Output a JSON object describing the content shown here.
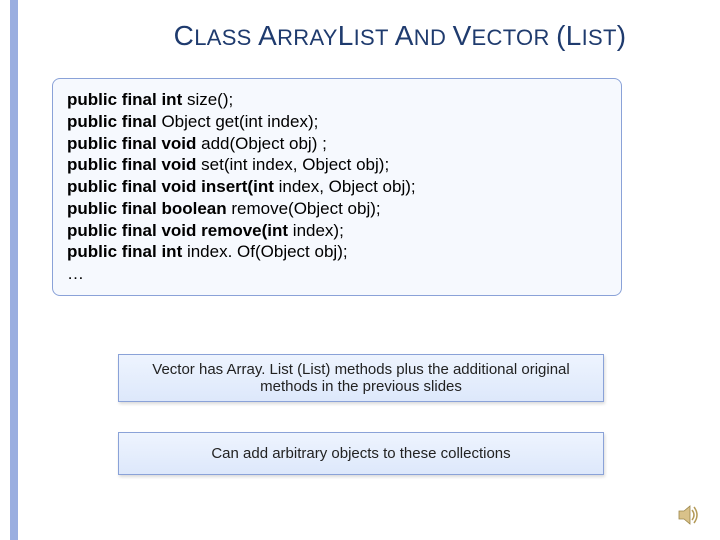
{
  "title": {
    "t1_big": "C",
    "t1_small": "LASS ",
    "t2_big": "A",
    "t2_small": "RRAY",
    "t3_big": "L",
    "t3_small": "IST ",
    "t4_big": "A",
    "t4_small": "ND ",
    "t5_big": "V",
    "t5_small": "ECTOR ",
    "paren_open": "(",
    "t6_big": "L",
    "t6_small": "IST",
    "paren_close": ")"
  },
  "code": {
    "kw": "public final",
    "l1_type": " int ",
    "l1_rest": "size();",
    "l2_type": " Object ",
    "l2_rest": "get(int index);",
    "l3_type": " void ",
    "l3_rest": "add(Object obj) ;",
    "l4_type": " void ",
    "l4_rest": "set(int index, Object obj);",
    "l5_type": " void ",
    "l5_rest": "insert(int",
    "l5_rest2": " index,  Object obj);",
    "l6_type": " boolean ",
    "l6_rest": "remove(Object obj);",
    "l7_type": " void ",
    "l7_rest": "remove(int",
    "l7_rest2": " index);",
    "l8_type": " int ",
    "l8_rest": "index. Of(Object obj);",
    "l9": "…"
  },
  "info1_line1": "Vector has Array. List (List) methods plus the additional original",
  "info1_line2": "methods in the previous slides",
  "info2": "Can add arbitrary objects to these collections"
}
